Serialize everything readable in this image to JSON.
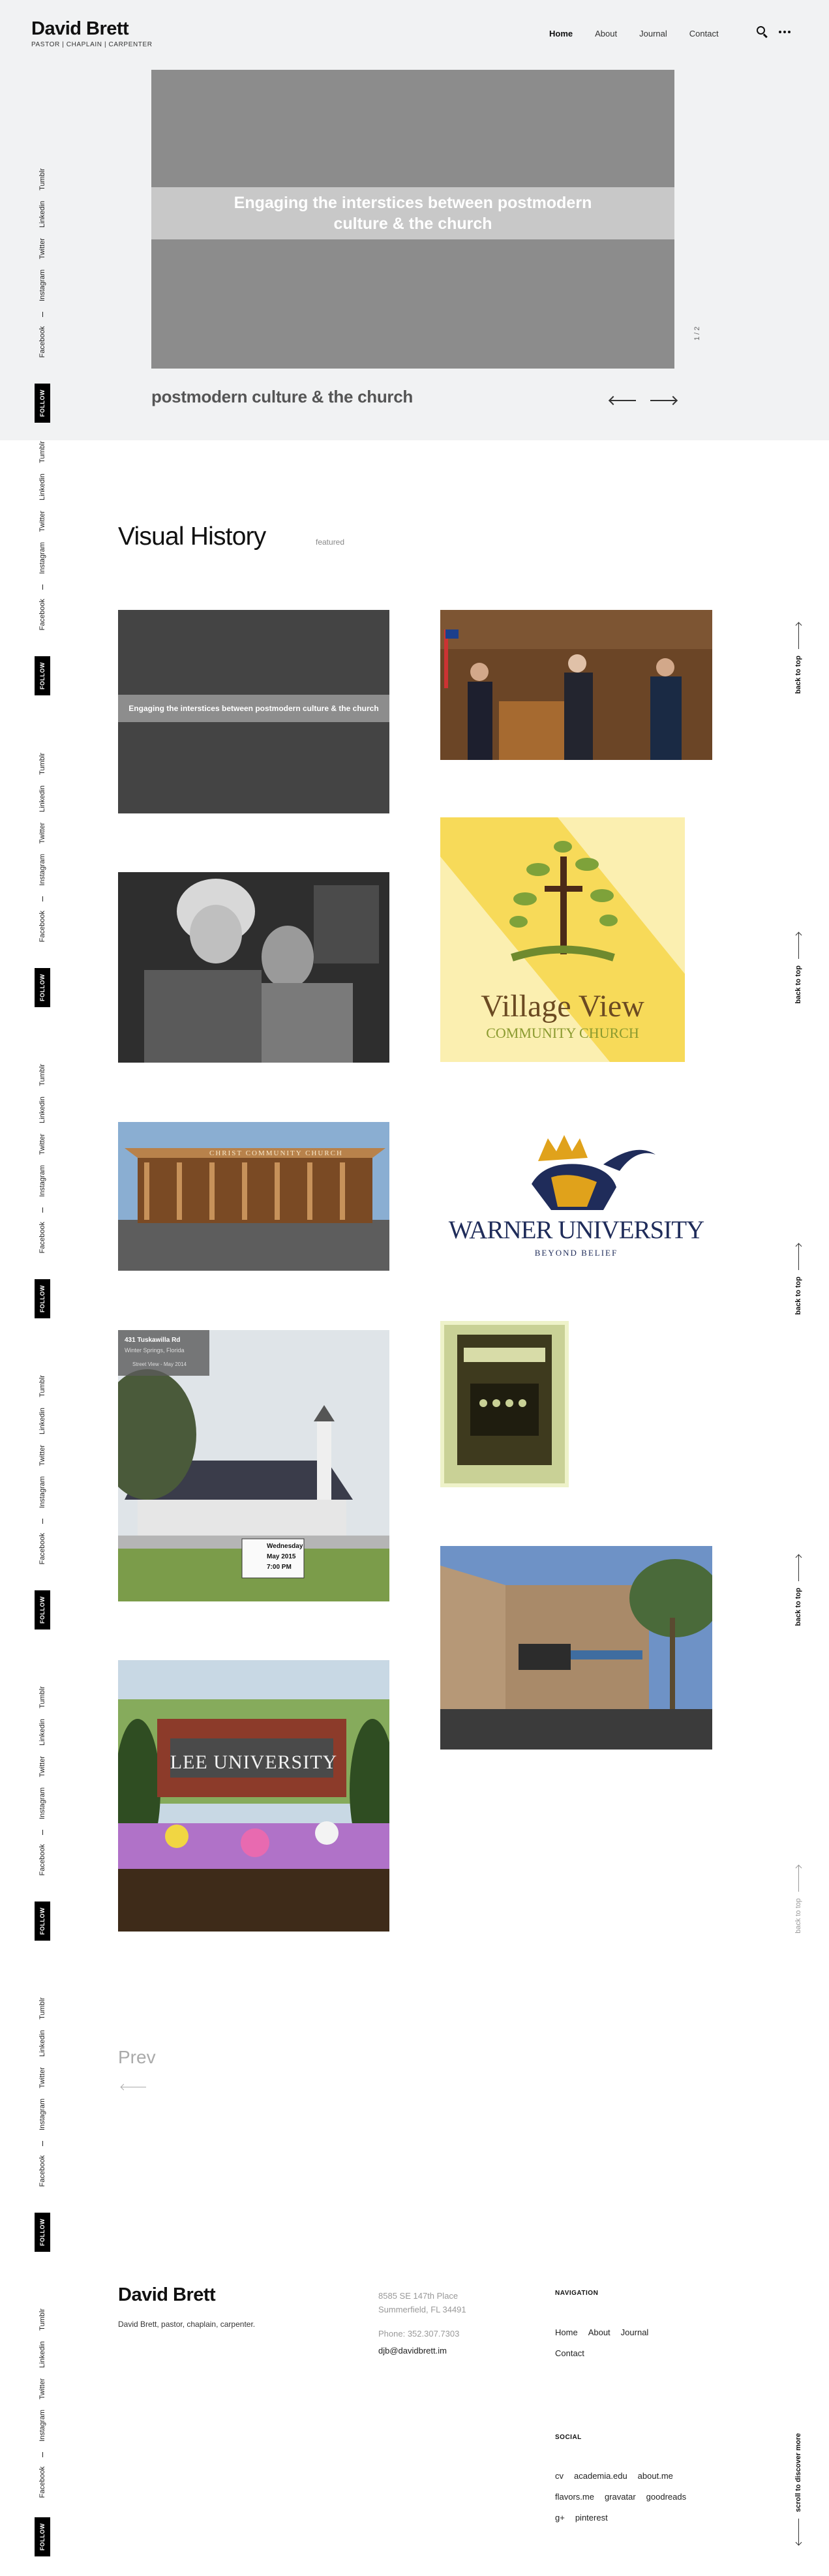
{
  "site": {
    "title": "David Brett",
    "tagline": "PASTOR | CHAPLAIN | CARPENTER"
  },
  "nav": {
    "items": [
      {
        "label": "Home",
        "active": true
      },
      {
        "label": "About"
      },
      {
        "label": "Journal"
      },
      {
        "label": "Contact"
      }
    ],
    "search_icon": "search-icon",
    "menu_icon": "more-dots-icon"
  },
  "hero": {
    "slide_headline": "Engaging the interstices between postmodern culture & the church",
    "caption": "postmodern culture & the church",
    "counter": "1 / 2"
  },
  "social": {
    "links": [
      "Tumblr",
      "Linkedin",
      "Twitter",
      "Instagram",
      "Facebook"
    ],
    "follow": "FOLLOW"
  },
  "gallery": {
    "title": "Visual History",
    "filter": "featured",
    "tiles": [
      {
        "kind": "text-slide",
        "text": "Engaging the interstices between postmodern culture & the church"
      },
      {
        "kind": "photo",
        "subject": "men at podium"
      },
      {
        "kind": "photo",
        "subject": "elderly women embrace"
      },
      {
        "kind": "logo",
        "line1": "Village View",
        "line2": "COMMUNITY CHURCH"
      },
      {
        "kind": "photo",
        "subject": "church building",
        "sign": "CHRIST COMMUNITY CHURCH"
      },
      {
        "kind": "logo",
        "line1": "WARNER UNIVERSITY",
        "line2": "BEYOND BELIEF"
      },
      {
        "kind": "photo",
        "subject": "street view church",
        "overlay_line1": "431 Tuskawilla Rd",
        "overlay_line2": "Winter Springs, Florida",
        "overlay_line3": "Street View - May 2014",
        "sign_line1": "Wednesday",
        "sign_line2": "May 2015",
        "sign_line3": "7:00 PM"
      },
      {
        "kind": "photo",
        "subject": "typewriter"
      },
      {
        "kind": "photo",
        "subject": "shopping center church"
      },
      {
        "kind": "photo",
        "subject": "university sign",
        "sign": "LEE UNIVERSITY"
      }
    ],
    "back_to_top": "back to top"
  },
  "pagination": {
    "prev": "Prev"
  },
  "footer": {
    "name": "David Brett",
    "description": "David Brett, pastor, chaplain, carpenter.",
    "address_line1": "8585 SE 147th Place",
    "address_line2": "Summerfield, FL 34491",
    "phone": "Phone: 352.307.7303",
    "email": "djb@davidbrett.im",
    "navigation_heading": "NAVIGATION",
    "navigation": [
      "Home",
      "About",
      "Journal",
      "Contact"
    ],
    "social_heading": "SOCIAL",
    "social": [
      "cv",
      "academia.edu",
      "about.me",
      "flavors.me",
      "gravatar",
      "goodreads",
      "g+",
      "pinterest"
    ],
    "scroll_more": "scroll to discover more"
  },
  "colors": {
    "hero_band": "#f1f2f3",
    "slide_bg": "#8c8c8c",
    "follow_bg": "#000000",
    "village_green": "#6f8a2e",
    "warner_navy": "#1f2c5a",
    "warner_gold": "#e0a21b"
  }
}
